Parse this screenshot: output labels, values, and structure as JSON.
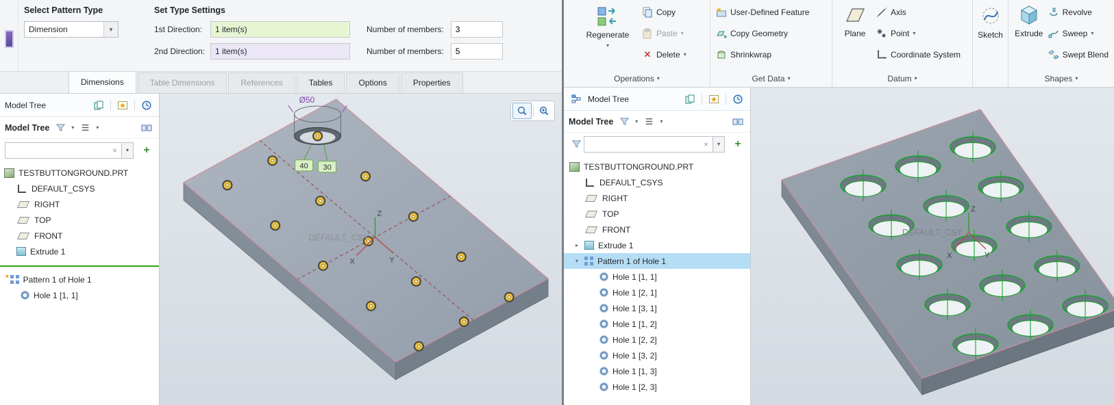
{
  "glyphs": {
    "caret_down": "▾",
    "arrow_collapsed": "▸",
    "arrow_expanded": "▾",
    "close": "×",
    "plus": "+",
    "asterisk": "*",
    "delete_x": "✕"
  },
  "left": {
    "dashboard": {
      "select_pattern_type": "Select Pattern Type",
      "pattern_type": "Dimension",
      "set_type_settings": "Set Type Settings",
      "dir1_label": "1st Direction:",
      "dir1_value": "1 item(s)",
      "members1_label": "Number of members:",
      "members1_value": "3",
      "dir2_label": "2nd Direction:",
      "dir2_value": "1 item(s)",
      "members2_label": "Number of members:",
      "members2_value": "5"
    },
    "tabs": [
      {
        "label": "Dimensions"
      },
      {
        "label": "Table Dimensions"
      },
      {
        "label": "References"
      },
      {
        "label": "Tables"
      },
      {
        "label": "Options"
      },
      {
        "label": "Properties"
      }
    ],
    "tree": {
      "tab_title": "Model Tree",
      "panel_title": "Model Tree",
      "items": [
        {
          "label": "TESTBUTTONGROUND.PRT"
        },
        {
          "label": "DEFAULT_CSYS"
        },
        {
          "label": "RIGHT"
        },
        {
          "label": "TOP"
        },
        {
          "label": "FRONT"
        },
        {
          "label": "Extrude 1"
        },
        {
          "label": "Pattern 1 of Hole 1"
        },
        {
          "label": "Hole 1 [1, 1]"
        }
      ]
    },
    "viewport": {
      "dia_label": "Ø50",
      "dim1": "40",
      "dim2": "30",
      "csys_label": "DEFAULT_CSY",
      "x": "X",
      "y": "Y",
      "z": "Z"
    }
  },
  "right": {
    "ribbon": {
      "regenerate": "Regenerate",
      "copy": "Copy",
      "paste": "Paste",
      "delete": "Delete",
      "udf": "User-Defined Feature",
      "copy_geometry": "Copy Geometry",
      "shrinkwrap": "Shrinkwrap",
      "plane": "Plane",
      "axis": "Axis",
      "point": "Point",
      "coordinate_system": "Coordinate System",
      "sketch": "Sketch",
      "extrude": "Extrude",
      "revolve": "Revolve",
      "sweep": "Sweep",
      "swept_blend": "Swept Blend",
      "groups": {
        "operations": "Operations",
        "get_data": "Get Data",
        "datum": "Datum",
        "shapes": "Shapes"
      }
    },
    "tree": {
      "tab_title": "Model Tree",
      "panel_title": "Model Tree",
      "items": [
        {
          "label": "TESTBUTTONGROUND.PRT"
        },
        {
          "label": "DEFAULT_CSYS"
        },
        {
          "label": "RIGHT"
        },
        {
          "label": "TOP"
        },
        {
          "label": "FRONT"
        },
        {
          "label": "Extrude 1"
        },
        {
          "label": "Pattern 1 of Hole 1"
        },
        {
          "label": "Hole 1 [1, 1]"
        },
        {
          "label": "Hole 1 [2, 1]"
        },
        {
          "label": "Hole 1 [3, 1]"
        },
        {
          "label": "Hole 1 [1, 2]"
        },
        {
          "label": "Hole 1 [2, 2]"
        },
        {
          "label": "Hole 1 [3, 2]"
        },
        {
          "label": "Hole 1 [1, 3]"
        },
        {
          "label": "Hole 1 [2, 3]"
        }
      ]
    },
    "viewport": {
      "csys_label": "DEFAULT_CSY",
      "x": "X",
      "y": "Y",
      "z": "Z"
    }
  }
}
